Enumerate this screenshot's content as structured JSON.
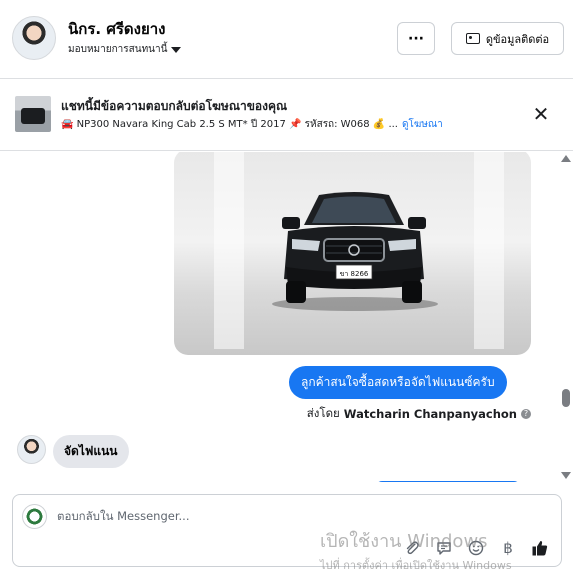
{
  "header": {
    "name": "นิกร. ศรีดงยาง",
    "assign_label": "มอบหมายการสนทนานี้",
    "more_label": "···",
    "contact_label": "ดูข้อมูลติดต่อ"
  },
  "ad_banner": {
    "title": "แชทนี้มีข้อความตอบกลับต่อโฆษณาของคุณ",
    "details": "🚘 NP300 Navara King Cab 2.5 S MT* ปี 2017 📌 รหัสรถ: W068 💰 ...",
    "link": "ดูโฆษณา",
    "close_label": "✕"
  },
  "conversation": {
    "outgoing_message": "ลูกค้าสนใจซื้อสดหรือจัดไฟแนนซ์ครับ",
    "sent_by_prefix": "ส่งโดย",
    "sent_by_name": "Watcharin Chanpanyachon",
    "incoming_message": "จัดไฟแนน",
    "car_plate": "ขา 8266"
  },
  "composer": {
    "placeholder": "ตอบกลับใน Messenger..."
  },
  "watermark": {
    "line1": "เปิดใช้งาน Windows",
    "line2": "ไปที่ การตั้งค่า เพื่อเปิดใช้งาน Windows"
  },
  "colors": {
    "accent": "#1877f2",
    "bubble_in": "#e4e6eb"
  },
  "icons": [
    "more-icon",
    "contact-card-icon",
    "close-icon",
    "attach-icon",
    "saved-reply-icon",
    "emoji-icon",
    "currency-icon",
    "like-icon",
    "info-icon"
  ]
}
